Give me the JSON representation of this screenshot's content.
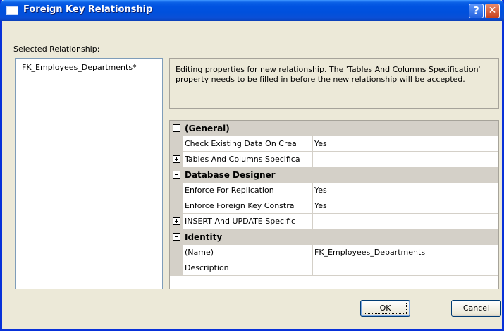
{
  "window": {
    "title": "Foreign Key Relationship",
    "help_glyph": "?",
    "close_glyph": "✕"
  },
  "selected_relationship": {
    "label": "Selected Relationship:",
    "items": [
      "FK_Employees_Departments*"
    ]
  },
  "info": {
    "text": "Editing properties for new relationship.  The 'Tables And Columns Specification' property needs to be filled in before the new relationship will be accepted."
  },
  "properties": {
    "categories": [
      {
        "name": "(General)",
        "expanded": true,
        "rows": [
          {
            "name": "Check Existing Data On Crea",
            "value": "Yes",
            "expandable": false
          },
          {
            "name": "Tables And Columns Specifica",
            "value": "",
            "expandable": true
          }
        ]
      },
      {
        "name": "Database Designer",
        "expanded": true,
        "rows": [
          {
            "name": "Enforce For Replication",
            "value": "Yes",
            "expandable": false
          },
          {
            "name": "Enforce Foreign Key Constra",
            "value": "Yes",
            "expandable": false
          },
          {
            "name": "INSERT And UPDATE Specific",
            "value": "",
            "expandable": true
          }
        ]
      },
      {
        "name": "Identity",
        "expanded": true,
        "rows": [
          {
            "name": "(Name)",
            "value": "FK_Employees_Departments",
            "expandable": false
          },
          {
            "name": "Description",
            "value": "",
            "expandable": false
          }
        ]
      }
    ]
  },
  "buttons": {
    "ok": "OK",
    "cancel": "Cancel"
  },
  "colors": {
    "titlebar": "#0053e1",
    "dialog_bg": "#ece9d8",
    "category_bg": "#d4d0c8"
  }
}
